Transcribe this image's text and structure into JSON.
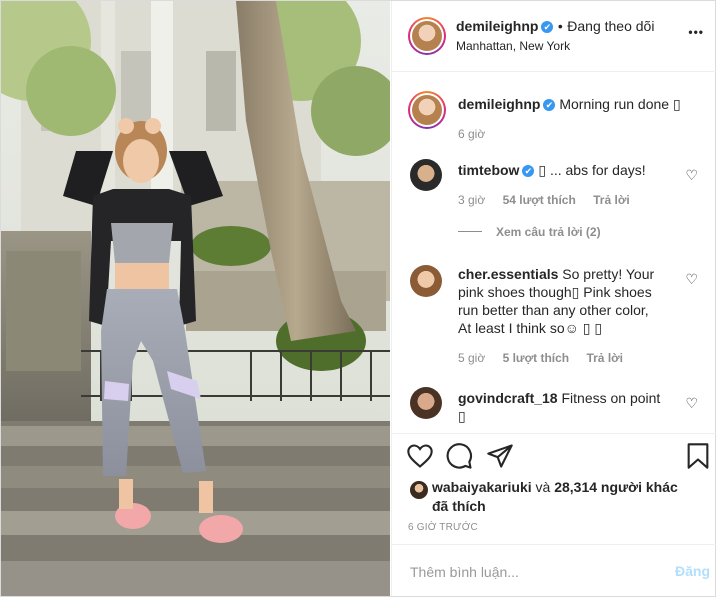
{
  "header": {
    "username": "demileighnp",
    "verified_mark": "✔",
    "separator": "•",
    "follow_status": "Đang theo dõi",
    "location": "Manhattan, New York",
    "more_label": "•••"
  },
  "caption": {
    "username": "demileighnp",
    "text": "Morning run done ▯",
    "time": "6 giờ"
  },
  "comments": [
    {
      "username": "timtebow",
      "text": "▯ ... abs for days!",
      "time": "3 giờ",
      "likes": "54 lượt thích",
      "reply": "Trả lời",
      "view_replies": "Xem câu trả lời (2)"
    },
    {
      "username": "cher.essentials",
      "text_lines": [
        "So pretty! Your",
        "pink shoes though▯ Pink shoes",
        "run better than any other color,",
        "At least I think so☺ ▯ ▯"
      ],
      "time": "5 giờ",
      "likes": "5 lượt thích",
      "reply": "Trả lời"
    },
    {
      "username": "govindcraft_18",
      "text_lines": [
        "Fitness on point",
        "▯"
      ]
    }
  ],
  "likes": {
    "liker": "wabaiyakariuki",
    "connector": "và",
    "others": "28,314 người khác",
    "suffix": "đã thích"
  },
  "time_ago": "6 GIỜ TRƯỚC",
  "add_comment": {
    "placeholder": "Thêm bình luận...",
    "post_label": "Đăng"
  },
  "colors": {
    "verified": "#3897f0",
    "post_disabled": "#b2dffc",
    "meta_gray": "#8e8e8e"
  },
  "icons": [
    "heart-icon",
    "comment-icon",
    "share-icon",
    "bookmark-icon",
    "more-icon",
    "verified-icon"
  ]
}
